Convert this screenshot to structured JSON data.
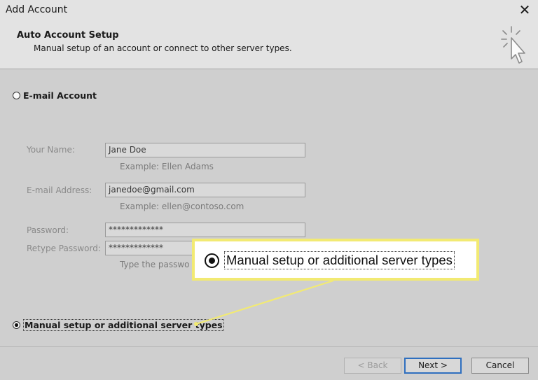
{
  "window": {
    "title": "Add Account",
    "close_glyph": "✕"
  },
  "header": {
    "title": "Auto Account Setup",
    "subtitle": "Manual setup of an account or connect to other server types."
  },
  "email_option": {
    "label": "E-mail Account",
    "selected": false
  },
  "form": {
    "name_label": "Your Name:",
    "name_value": "Jane Doe",
    "name_hint": "Example: Ellen Adams",
    "email_label": "E-mail Address:",
    "email_value": "janedoe@gmail.com",
    "email_hint": "Example: ellen@contoso.com",
    "password_label": "Password:",
    "password_value": "*************",
    "retype_label": "Retype Password:",
    "retype_value": "*************",
    "password_hint": "Type the passwo"
  },
  "manual_option": {
    "label": "Manual setup or additional server types",
    "selected": true
  },
  "callout": {
    "label": "Manual setup or additional server types"
  },
  "buttons": {
    "back": "< Back",
    "next": "Next >",
    "cancel": "Cancel"
  },
  "colors": {
    "highlight": "#f2ea73",
    "default_button_border": "#2f6fbf"
  }
}
